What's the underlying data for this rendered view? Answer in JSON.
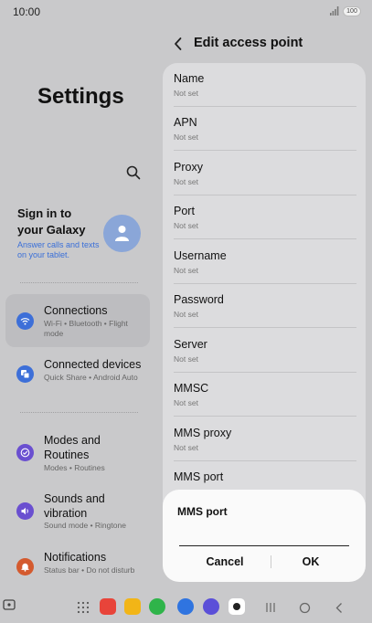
{
  "status_bar": {
    "time": "10:00",
    "battery": "100",
    "signal_icon": "signal-icon"
  },
  "settings_panel": {
    "title": "Settings",
    "search_icon": "search-icon",
    "account": {
      "title": "Sign in to your Galaxy",
      "subtitle": "Answer calls and texts on your tablet.",
      "avatar_icon": "person-icon"
    },
    "items": [
      {
        "label": "Connections",
        "sub": "Wi-Fi  •  Bluetooth  •  Flight mode",
        "icon": "wifi-icon",
        "icon_color": "#3d6fd8",
        "selected": true
      },
      {
        "label": "Connected devices",
        "sub": "Quick Share  •  Android Auto",
        "icon": "devices-icon",
        "icon_color": "#3d6fd8",
        "selected": false
      },
      {
        "label": "Modes and Routines",
        "sub": "Modes  •  Routines",
        "icon": "check-circle-icon",
        "icon_color": "#6a4fd0",
        "selected": false
      },
      {
        "label": "Sounds and vibration",
        "sub": "Sound mode  •  Ringtone",
        "icon": "speaker-icon",
        "icon_color": "#6a4fd0",
        "selected": false
      },
      {
        "label": "Notifications",
        "sub": "Status bar  •  Do not disturb",
        "icon": "bell-icon",
        "icon_color": "#d45a2e",
        "selected": false
      }
    ]
  },
  "access_point": {
    "title": "Edit access point",
    "back_icon": "back-arrow-icon",
    "fields": [
      {
        "label": "Name",
        "value": "Not set"
      },
      {
        "label": "APN",
        "value": "Not set"
      },
      {
        "label": "Proxy",
        "value": "Not set"
      },
      {
        "label": "Port",
        "value": "Not set"
      },
      {
        "label": "Username",
        "value": "Not set"
      },
      {
        "label": "Password",
        "value": "Not set"
      },
      {
        "label": "Server",
        "value": "Not set"
      },
      {
        "label": "MMSC",
        "value": "Not set"
      },
      {
        "label": "MMS proxy",
        "value": "Not set"
      },
      {
        "label": "MMS port",
        "value": ""
      }
    ]
  },
  "dialog": {
    "title": "MMS port",
    "input_value": "",
    "cancel_label": "Cancel",
    "ok_label": "OK"
  },
  "taskbar": {
    "apps": [
      {
        "name": "apps-grid-icon",
        "color": "#555555"
      },
      {
        "name": "samsung-notes-icon",
        "color": "#e8443a"
      },
      {
        "name": "my-files-icon",
        "color": "#f2b517"
      },
      {
        "name": "phone-icon",
        "color": "#2fb44a"
      },
      {
        "name": "messages-icon",
        "color": "#2f74e0"
      },
      {
        "name": "internet-icon",
        "color": "#5b4fd8"
      },
      {
        "name": "camera-icon",
        "color": "#222222"
      }
    ],
    "nav": [
      "recents-icon",
      "home-icon",
      "back-nav-icon"
    ]
  }
}
